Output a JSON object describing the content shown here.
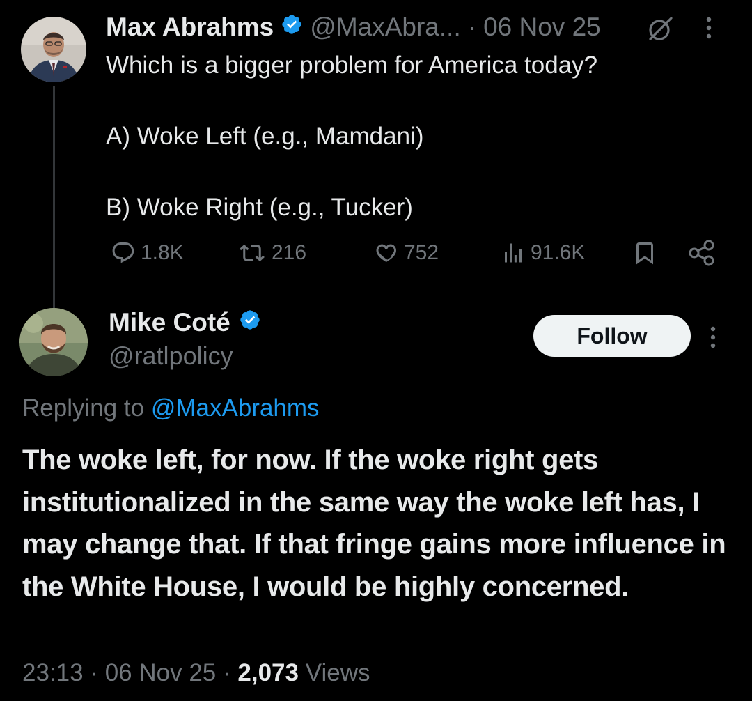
{
  "parent_tweet": {
    "author_name": "Max Abrahms",
    "handle": "@MaxAbra...",
    "separator": "·",
    "date": "06 Nov 25",
    "text": "Which is a bigger problem for America today?\n\nA) Woke Left (e.g., Mamdani)\n\nB) Woke Right (e.g., Tucker)",
    "stats": {
      "replies": "1.8K",
      "reposts": "216",
      "likes": "752",
      "views": "91.6K"
    },
    "icons": {
      "verified": "verified-badge-icon",
      "grok": "grok-icon",
      "more": "more-vertical-icon",
      "reply": "reply-icon",
      "repost": "repost-icon",
      "like": "heart-icon",
      "views": "views-chart-icon",
      "bookmark": "bookmark-icon",
      "share": "share-icon"
    }
  },
  "reply_tweet": {
    "author_name": "Mike Coté",
    "handle": "@ratlpolicy",
    "follow_label": "Follow",
    "replying_prefix": "Replying to",
    "replying_to": "@MaxAbrahms",
    "text": "The woke left, for now. If the woke right gets institutionalized in the same way the woke left has, I may change that. If that fringe gains more influence in the White House, I would be highly concerned.",
    "time": "23:13",
    "separator": "·",
    "date": "06 Nov 25",
    "view_count": "2,073",
    "views_label": "Views"
  },
  "colors": {
    "background": "#000000",
    "text": "#e7e9ea",
    "muted": "#71767b",
    "link": "#1d9bf0",
    "verified": "#1d9bf0",
    "follow_button_bg": "#eff3f4",
    "follow_button_text": "#0f1419"
  }
}
